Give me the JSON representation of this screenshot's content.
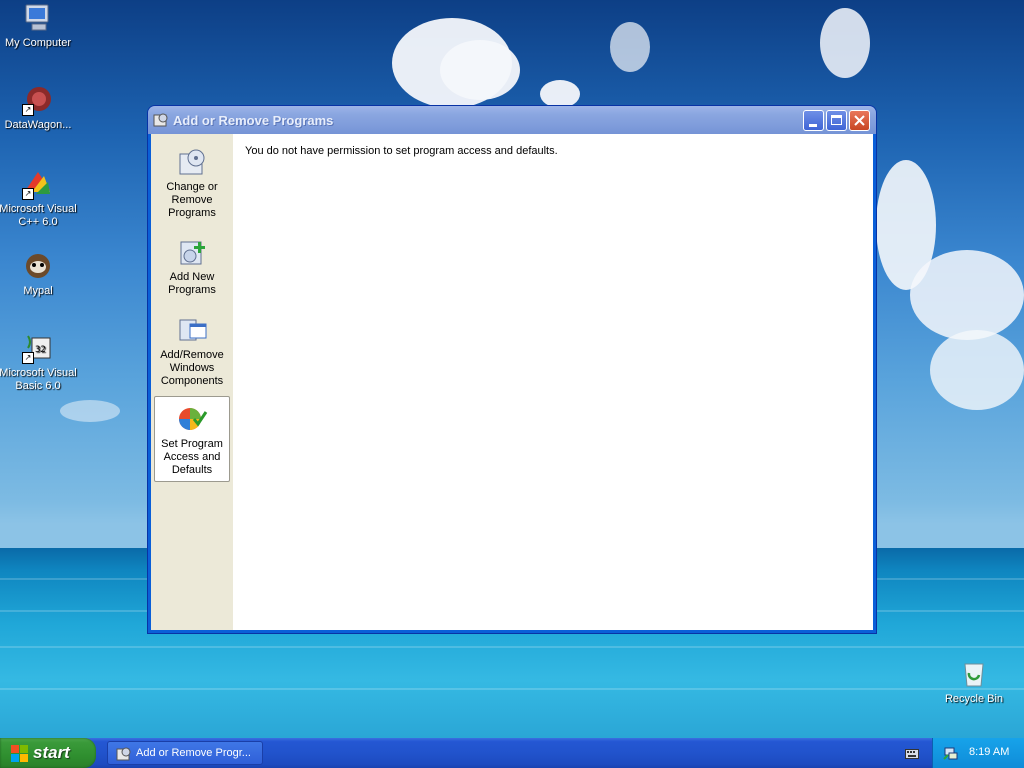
{
  "desktop": {
    "icons": [
      {
        "label": "My Computer",
        "icon": "my-computer-icon"
      },
      {
        "label": "DataWagon...",
        "icon": "datawagon-icon"
      },
      {
        "label": "Microsoft Visual C++ 6.0",
        "icon": "visual-cpp-icon"
      },
      {
        "label": "Mypal",
        "icon": "mypal-icon"
      },
      {
        "label": "Microsoft Visual Basic 6.0",
        "icon": "visual-basic-icon"
      },
      {
        "label": "Recycle Bin",
        "icon": "recycle-bin-icon"
      }
    ]
  },
  "window": {
    "title": "Add or Remove Programs",
    "sidebar": {
      "items": [
        {
          "line1": "Change or",
          "line2": "Remove",
          "line3": "Programs",
          "icon": "change-remove-programs-icon",
          "active": false
        },
        {
          "line1": "Add New",
          "line2": "Programs",
          "line3": "",
          "icon": "add-new-programs-icon",
          "active": false
        },
        {
          "line1": "Add/Remove",
          "line2": "Windows",
          "line3": "Components",
          "icon": "windows-components-icon",
          "active": false
        },
        {
          "line1": "Set Program",
          "line2": "Access and",
          "line3": "Defaults",
          "icon": "set-program-access-icon",
          "active": true
        }
      ]
    },
    "content": {
      "message": "You do not have permission to set program access and defaults."
    }
  },
  "taskbar": {
    "start_label": "start",
    "task_button_label": "Add or Remove Progr...",
    "clock": "8:19 AM"
  },
  "colors": {
    "titlebar_inactive": "#7f9cdb",
    "taskbar_blue": "#2153cc",
    "start_green": "#3a9a3a",
    "tray_blue": "#0f8cd8",
    "sidebar_bg": "#ece9d8"
  }
}
